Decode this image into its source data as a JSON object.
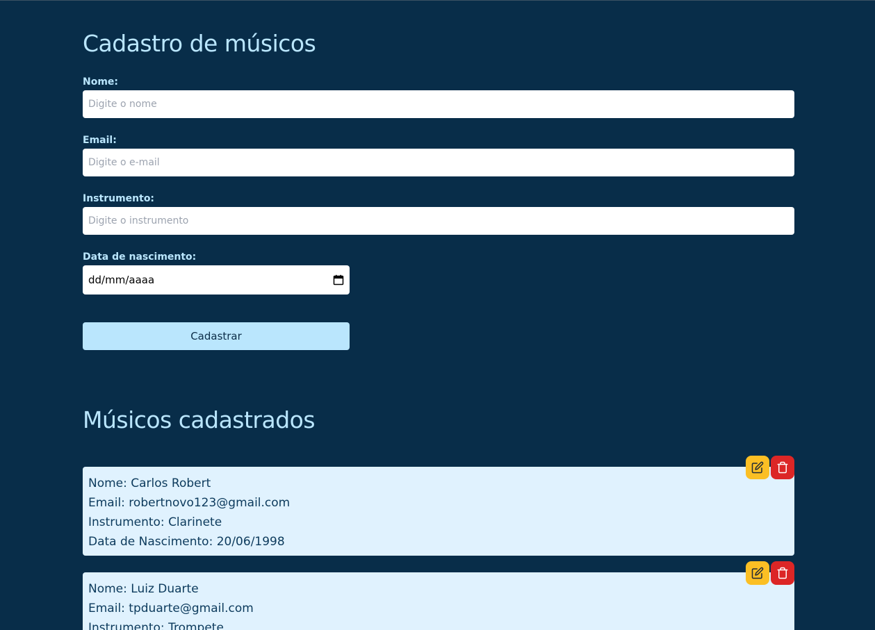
{
  "form": {
    "title": "Cadastro de músicos",
    "name_label": "Nome:",
    "name_placeholder": "Digite o nome",
    "email_label": "Email:",
    "email_placeholder": "Digite o e-mail",
    "instrument_label": "Instrumento:",
    "instrument_placeholder": "Digite o instrumento",
    "birth_label": "Data de nascimento:",
    "birth_value": "dd/mm/aaaa",
    "submit_label": "Cadastrar"
  },
  "list": {
    "title": "Músicos cadastrados",
    "musicians": [
      {
        "name": "Nome: Carlos Robert",
        "email": "Email: robertnovo123@gmail.com",
        "instrument": "Instrumento: Clarinete",
        "birth": "Data de Nascimento: 20/06/1998"
      },
      {
        "name": "Nome: Luiz Duarte",
        "email": "Email: tpduarte@gmail.com",
        "instrument": "Instrumento: Trompete"
      }
    ]
  },
  "icons": {
    "edit": "pencil-square-icon",
    "delete": "trash-icon",
    "calendar": "calendar-icon"
  },
  "colors": {
    "background": "#082d49",
    "accent": "#bae6fd",
    "card": "#e0f2fe",
    "edit": "#fbbf24",
    "delete": "#dc2626"
  }
}
